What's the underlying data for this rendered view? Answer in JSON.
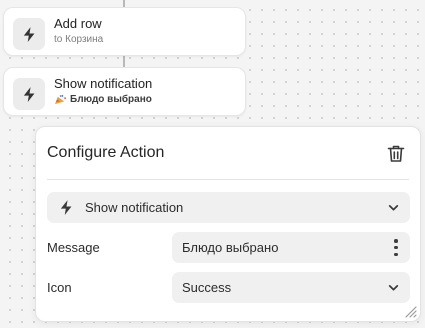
{
  "nodes": [
    {
      "title": "Add row",
      "subtitle": "to Корзина",
      "icon": "lightning-icon"
    },
    {
      "title": "Show notification",
      "subtitle": "Блюдо выбрано",
      "icon": "lightning-icon",
      "subtitle_icon": "party-popper-icon"
    }
  ],
  "panel": {
    "title": "Configure Action",
    "delete_icon": "trash-icon",
    "action_type": {
      "value": "Show notification",
      "icon": "lightning-icon"
    },
    "fields": [
      {
        "label": "Message",
        "value": "Блюдо выбрано",
        "control": "text-with-menu"
      },
      {
        "label": "Icon",
        "value": "Success",
        "control": "select"
      }
    ]
  },
  "colors": {
    "canvas": "#f4f4f4",
    "card": "#ffffff",
    "field_bg": "#f0f0f0",
    "icon_box": "#ececec",
    "text": "#2b2b2b"
  }
}
